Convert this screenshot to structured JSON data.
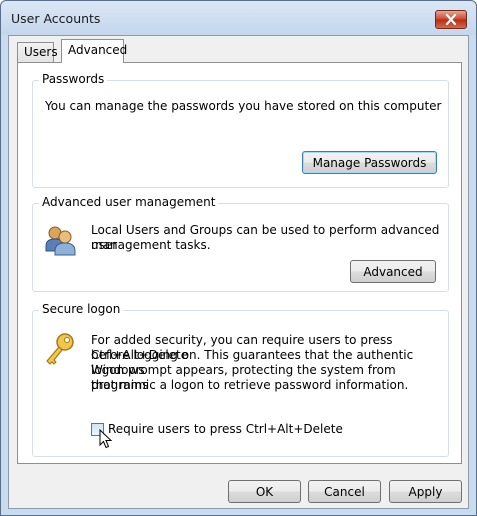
{
  "window": {
    "title": "User Accounts"
  },
  "tabs": [
    {
      "label": "Users",
      "active": false
    },
    {
      "label": "Advanced",
      "active": true
    }
  ],
  "passwords": {
    "label": "Passwords",
    "description": "You can manage the passwords you have stored on this computer",
    "button": "Manage Passwords"
  },
  "advanced_user_management": {
    "label": "Advanced user management",
    "description_line1": "Local Users and Groups can be used to perform advanced user",
    "description_line2": "management tasks.",
    "button": "Advanced"
  },
  "secure_logon": {
    "label": "Secure logon",
    "description_line1": "For added security, you can require users to press Ctrl+Alt+Delete",
    "description_line2": "before logging on. This guarantees that the authentic Windows",
    "description_line3": "logon prompt appears, protecting the system from programs",
    "description_line4": "that mimic a logon to retrieve password information.",
    "checkbox_label": "Require users to press Ctrl+Alt+Delete",
    "checkbox_checked": false
  },
  "footer": {
    "ok": "OK",
    "cancel": "Cancel",
    "apply": "Apply"
  }
}
